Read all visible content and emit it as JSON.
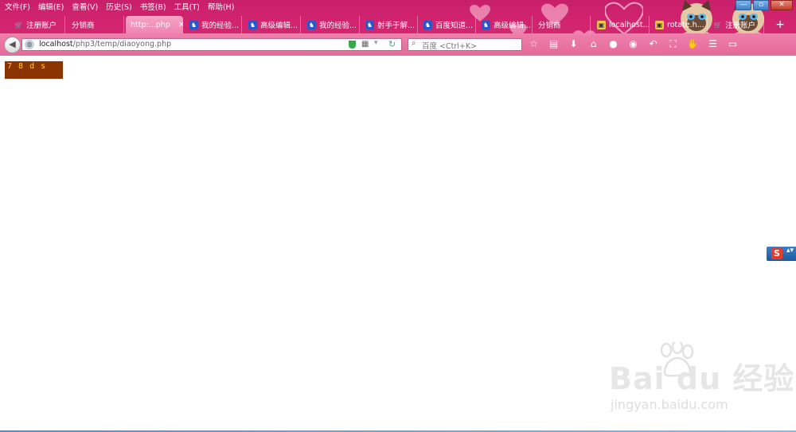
{
  "menubar": [
    "文件(F)",
    "编辑(E)",
    "查看(V)",
    "历史(S)",
    "书签(B)",
    "工具(T)",
    "帮助(H)"
  ],
  "window_controls": {
    "minimize": "—",
    "maximize": "▫",
    "close": "✕"
  },
  "tabs": [
    {
      "label": "注册账户",
      "icon": "cart-icon",
      "active": false
    },
    {
      "label": "分销商",
      "icon": "none",
      "active": false
    },
    {
      "label": "http:...php",
      "icon": "none",
      "active": true
    },
    {
      "label": "我的经验...",
      "icon": "baidu-icon",
      "active": false
    },
    {
      "label": "高级编辑...",
      "icon": "baidu-icon",
      "active": false
    },
    {
      "label": "我的经验...",
      "icon": "baidu-icon",
      "active": false
    },
    {
      "label": "射手于解...",
      "icon": "baidu-icon",
      "active": false
    },
    {
      "label": "百度知道...",
      "icon": "baidu-icon",
      "active": false
    },
    {
      "label": "高级编辑...",
      "icon": "baidu-icon",
      "active": false
    },
    {
      "label": "分销商",
      "icon": "none",
      "active": false
    },
    {
      "label": "localhost...",
      "icon": "image-icon",
      "active": false
    },
    {
      "label": "rotate.h...",
      "icon": "image-icon",
      "active": false
    },
    {
      "label": "注册账户",
      "icon": "cart-icon",
      "active": false
    }
  ],
  "new_tab_label": "+",
  "tab_close_glyph": "✕",
  "url": {
    "host": "localhost",
    "path": "/php3/temp/diaoyong.php"
  },
  "search_placeholder": "百度 <Ctrl+K>",
  "page": {
    "output_text": "7 8 d s"
  },
  "ime": {
    "letter": "S",
    "arrow": "▴▾"
  },
  "watermark": {
    "logo": "Bai du 经验",
    "url": "jingyan.baidu.com"
  },
  "colors": {
    "chrome": "#d2246f",
    "output_bg": "#8b3400",
    "output_fg": "#ffd700"
  }
}
